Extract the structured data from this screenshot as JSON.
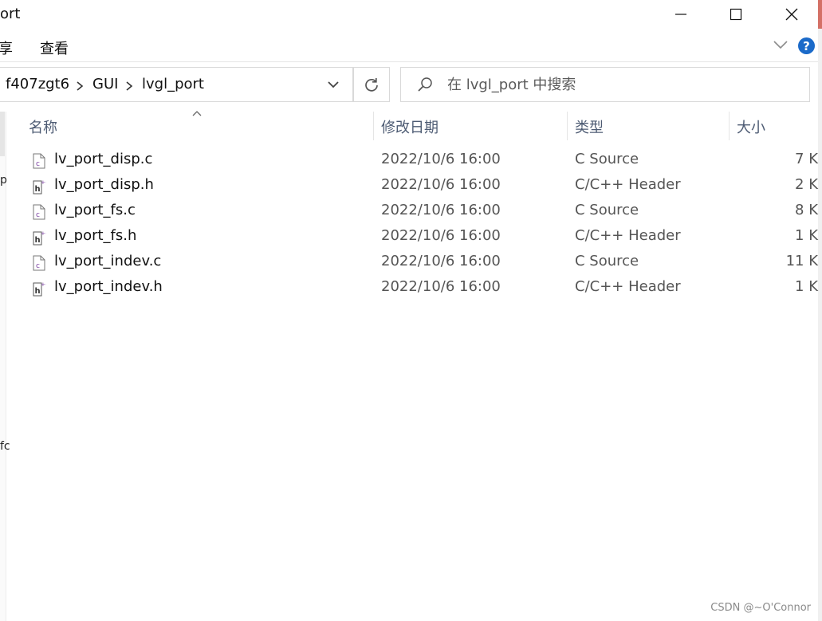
{
  "window": {
    "title": "ort"
  },
  "ribbon": {
    "tabs": [
      {
        "label": "享"
      },
      {
        "label": "查看"
      }
    ],
    "help_label": "?"
  },
  "address": {
    "crumbs": [
      "f407zgt6",
      "GUI",
      "lvgl_port"
    ]
  },
  "search": {
    "placeholder": "在 lvgl_port 中搜索"
  },
  "columns": {
    "name": "名称",
    "date": "修改日期",
    "type": "类型",
    "size": "大小"
  },
  "files": [
    {
      "name": "lv_port_disp.c",
      "date": "2022/10/6 16:00",
      "type": "C Source",
      "size": "7 K",
      "icon": "c-source-file-icon"
    },
    {
      "name": "lv_port_disp.h",
      "date": "2022/10/6 16:00",
      "type": "C/C++ Header",
      "size": "2 K",
      "icon": "cpp-header-file-icon"
    },
    {
      "name": "lv_port_fs.c",
      "date": "2022/10/6 16:00",
      "type": "C Source",
      "size": "8 K",
      "icon": "c-source-file-icon"
    },
    {
      "name": "lv_port_fs.h",
      "date": "2022/10/6 16:00",
      "type": "C/C++ Header",
      "size": "1 K",
      "icon": "cpp-header-file-icon"
    },
    {
      "name": "lv_port_indev.c",
      "date": "2022/10/6 16:00",
      "type": "C Source",
      "size": "11 K",
      "icon": "c-source-file-icon"
    },
    {
      "name": "lv_port_indev.h",
      "date": "2022/10/6 16:00",
      "type": "C/C++ Header",
      "size": "1 K",
      "icon": "cpp-header-file-icon"
    }
  ],
  "nav_fragments": [
    "p",
    "fc"
  ],
  "watermark": "CSDN @~O'Connor",
  "colors": {
    "accent": "#1b6ac9",
    "header_text": "#4d5b73",
    "c_icon": "#7a3fa0"
  }
}
